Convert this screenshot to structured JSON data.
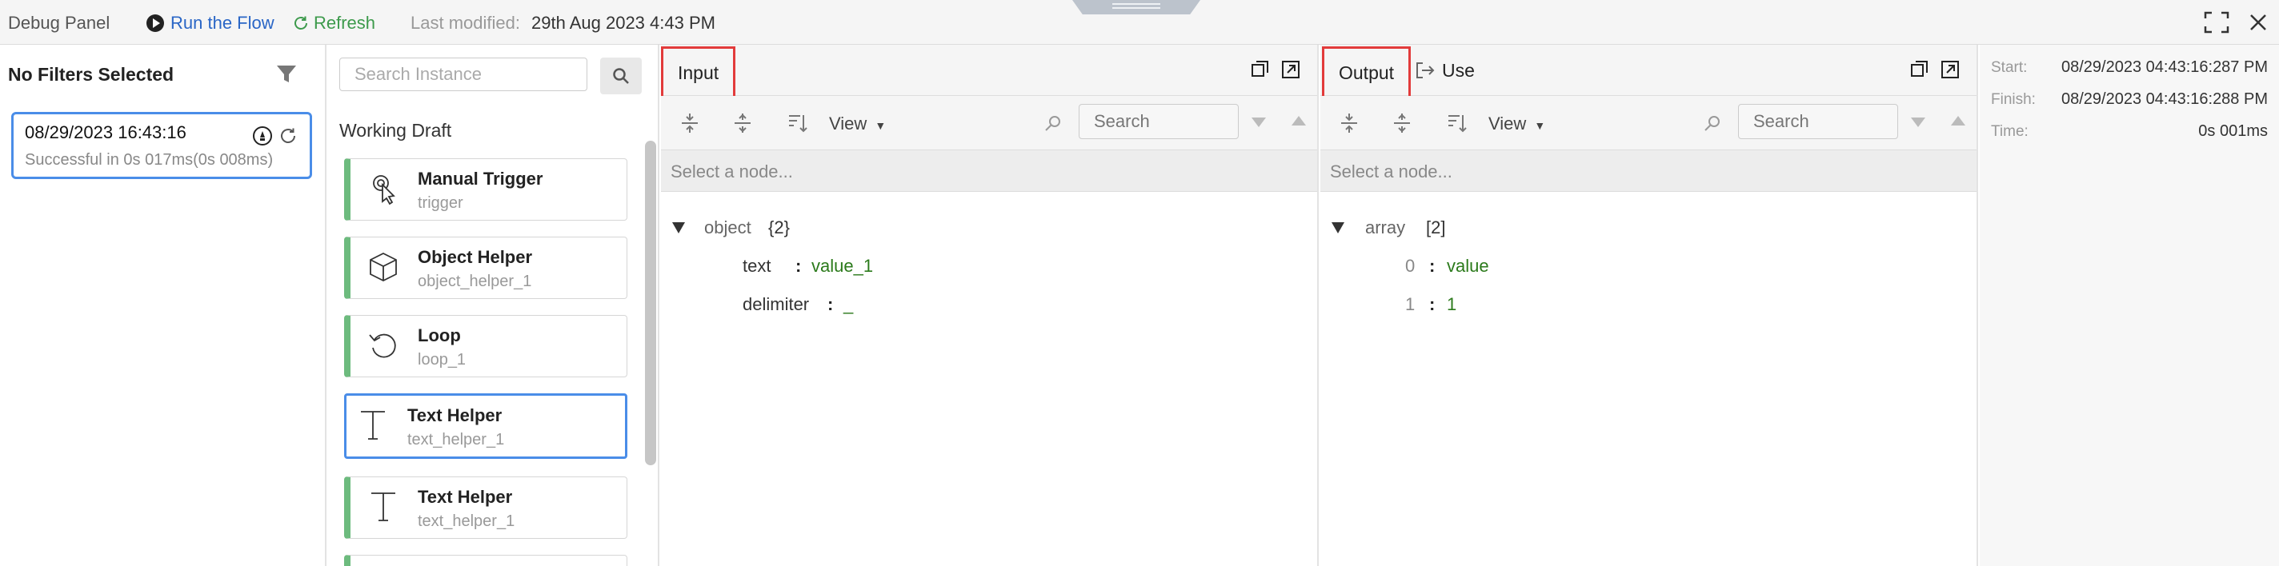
{
  "topbar": {
    "title": "Debug Panel",
    "run_label": "Run the Flow",
    "refresh_label": "Refresh",
    "last_modified_label": "Last modified:",
    "last_modified_value": "29th Aug 2023 4:43 PM",
    "colors": {
      "run": "#2a66c6",
      "refresh": "#3d9a4c"
    }
  },
  "runs": {
    "filter_label": "No Filters Selected",
    "items": [
      {
        "time": "08/29/2023 16:43:16",
        "status": "Successful in 0s 017ms(0s 008ms)"
      }
    ]
  },
  "nodes": {
    "search_placeholder": "Search Instance",
    "section_label": "Working Draft",
    "items": [
      {
        "title": "Manual Trigger",
        "subtitle": "trigger",
        "icon": "pointer-icon"
      },
      {
        "title": "Object Helper",
        "subtitle": "object_helper_1",
        "icon": "cube-icon"
      },
      {
        "title": "Loop",
        "subtitle": "loop_1",
        "icon": "loop-icon"
      },
      {
        "title": "Text Helper",
        "subtitle": "text_helper_1",
        "icon": "text-t-icon",
        "selected": true
      },
      {
        "title": "Text Helper",
        "subtitle": "text_helper_1",
        "icon": "text-t-icon"
      }
    ]
  },
  "input_panel": {
    "tab_label": "Input",
    "view_label": "View",
    "search_placeholder": "Search",
    "select_node_text": "Select a node...",
    "tree": {
      "root_key": "object",
      "root_count": "{2}",
      "entries": [
        {
          "key": "text",
          "value": "value_1"
        },
        {
          "key": "delimiter",
          "value": "_"
        }
      ]
    }
  },
  "output_panel": {
    "tab_label": "Output",
    "use_label": "Use",
    "view_label": "View",
    "search_placeholder": "Search",
    "select_node_text": "Select a node...",
    "tree": {
      "root_key": "array",
      "root_count": "[2]",
      "entries": [
        {
          "key": "0",
          "value": "value"
        },
        {
          "key": "1",
          "value": "1"
        }
      ]
    }
  },
  "timing": {
    "start_label": "Start:",
    "start_value": "08/29/2023 04:43:16:287 PM",
    "finish_label": "Finish:",
    "finish_value": "08/29/2023 04:43:16:288 PM",
    "time_label": "Time:",
    "time_value": "0s 001ms"
  },
  "theme": {
    "accent": "#4a8de8",
    "node_bar": "#6dbb7e",
    "highlight_box": "#e23b3b",
    "value_green": "#2b7a1b"
  }
}
